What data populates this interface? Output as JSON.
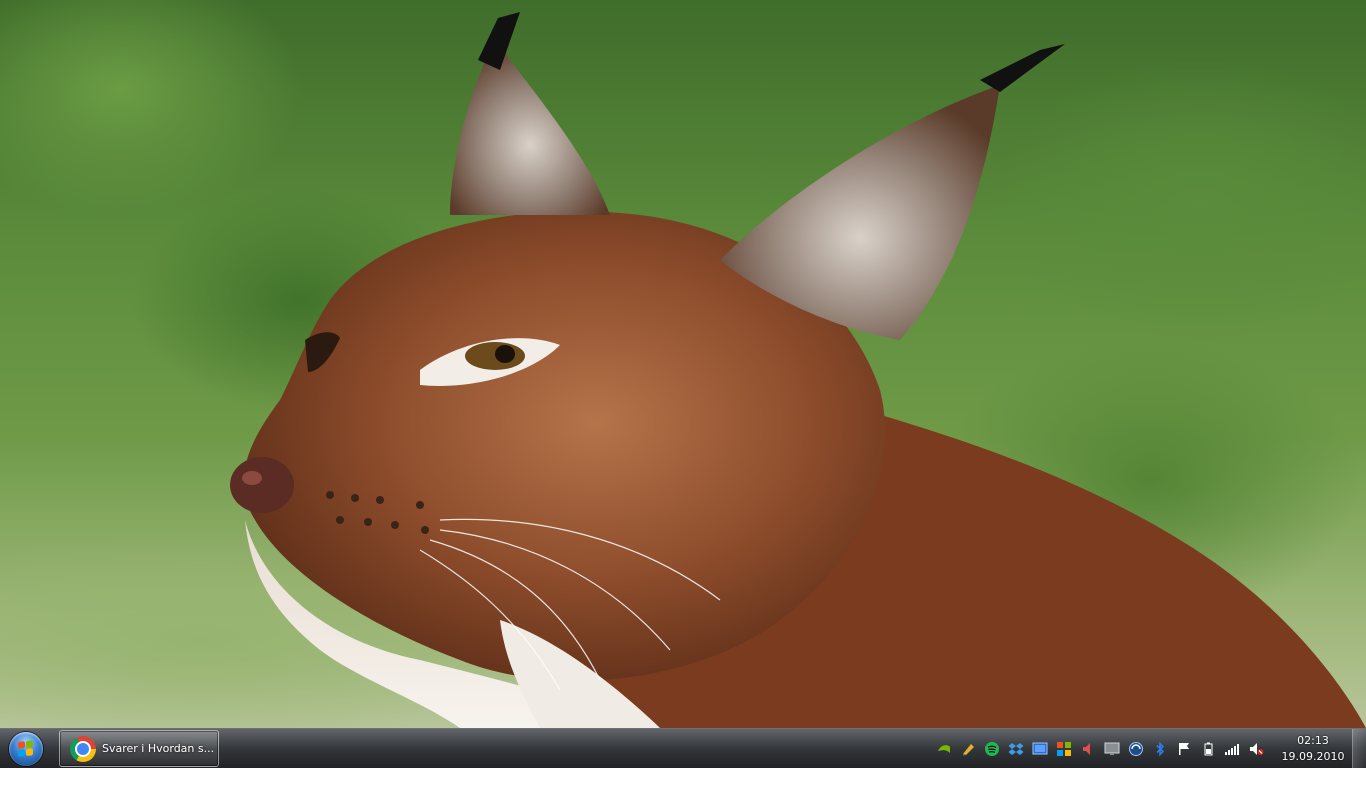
{
  "taskbar": {
    "start_button": {
      "icon": "windows-orb-icon"
    },
    "tasks": [
      {
        "label": "Svarer i Hvordan s...",
        "icon": "chrome-icon",
        "active": true
      }
    ],
    "tray_icons": [
      {
        "name": "nvidia-icon",
        "color": "#76b900"
      },
      {
        "name": "pen-tool-icon",
        "color": "#e0b030"
      },
      {
        "name": "spotify-icon",
        "color": "#1db954"
      },
      {
        "name": "dropbox-icon",
        "color": "#3d9ae8"
      },
      {
        "name": "monitor-icon",
        "color": "#2a6fd1"
      },
      {
        "name": "windows-update-icon",
        "color": "#f25022"
      },
      {
        "name": "speaker-icon",
        "color": "#e0504a"
      },
      {
        "name": "display-icon",
        "color": "#8a8f96"
      },
      {
        "name": "sync-icon",
        "color": "#5b9bd5"
      },
      {
        "name": "bluetooth-icon",
        "color": "#2b7de9"
      },
      {
        "name": "action-center-flag-icon",
        "color": "#ffffff"
      },
      {
        "name": "battery-icon",
        "color": "#ffffff"
      },
      {
        "name": "network-signal-icon",
        "color": "#ffffff"
      },
      {
        "name": "volume-muted-icon",
        "color": "#ffffff"
      }
    ],
    "clock": {
      "time": "02:13",
      "date": "19.09.2010"
    }
  },
  "colors": {
    "taskbar_bg": "#23262a",
    "wallpaper_foliage": "#5d8d3c",
    "lynx_fur": "#8a4a2a"
  }
}
